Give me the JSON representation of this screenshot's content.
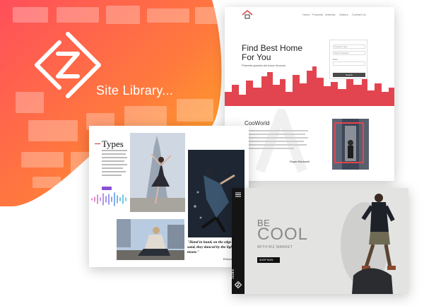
{
  "brand": {
    "label": "Site Library...",
    "logo_icon": "z-diamond-logo-icon",
    "gradient": [
      "#ff4f5a",
      "#ff7a3d",
      "#ffb020"
    ]
  },
  "real_estate_preview": {
    "title_line1": "Find Best Home",
    "title_line2": "For You",
    "subtitle": "Pharetra gravida dui fusce rhoncus",
    "nav": [
      "Home",
      "Property",
      "Amenity",
      "Gallery",
      "Contact Us"
    ],
    "form": {
      "field1": "Property Type",
      "field2": "Search location",
      "label_price": "Price",
      "button": "Search"
    },
    "section_title": "CooWorld",
    "signature": "Roger Buckwell",
    "accent": "#e2454f"
  },
  "types_preview": {
    "title": "Types",
    "quote": "\"Hand in hand, on the edge of the sand, they danced by the light of the moon.\"",
    "author": "Edward",
    "accent": "#8a4fd8"
  },
  "store_preview": {
    "be": "BE",
    "cool": "COOL",
    "with": "WITH BIZ MARKET",
    "button": "SHOP NOW",
    "vertical": "Store",
    "bg": "#e3e4e2"
  }
}
